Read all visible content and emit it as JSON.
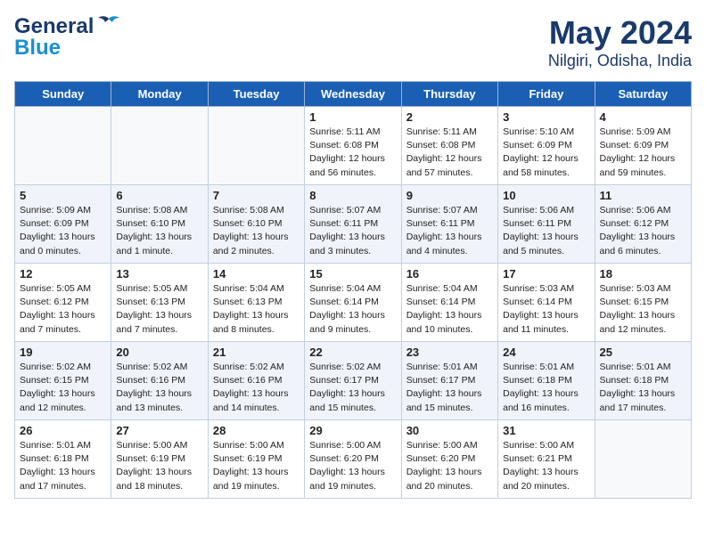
{
  "header": {
    "logo_line1": "General",
    "logo_line2": "Blue",
    "month": "May 2024",
    "location": "Nilgiri, Odisha, India"
  },
  "weekdays": [
    "Sunday",
    "Monday",
    "Tuesday",
    "Wednesday",
    "Thursday",
    "Friday",
    "Saturday"
  ],
  "weeks": [
    [
      {
        "day": "",
        "sunrise": "",
        "sunset": "",
        "daylight": ""
      },
      {
        "day": "",
        "sunrise": "",
        "sunset": "",
        "daylight": ""
      },
      {
        "day": "",
        "sunrise": "",
        "sunset": "",
        "daylight": ""
      },
      {
        "day": "1",
        "sunrise": "Sunrise: 5:11 AM",
        "sunset": "Sunset: 6:08 PM",
        "daylight": "Daylight: 12 hours and 56 minutes."
      },
      {
        "day": "2",
        "sunrise": "Sunrise: 5:11 AM",
        "sunset": "Sunset: 6:08 PM",
        "daylight": "Daylight: 12 hours and 57 minutes."
      },
      {
        "day": "3",
        "sunrise": "Sunrise: 5:10 AM",
        "sunset": "Sunset: 6:09 PM",
        "daylight": "Daylight: 12 hours and 58 minutes."
      },
      {
        "day": "4",
        "sunrise": "Sunrise: 5:09 AM",
        "sunset": "Sunset: 6:09 PM",
        "daylight": "Daylight: 12 hours and 59 minutes."
      }
    ],
    [
      {
        "day": "5",
        "sunrise": "Sunrise: 5:09 AM",
        "sunset": "Sunset: 6:09 PM",
        "daylight": "Daylight: 13 hours and 0 minutes."
      },
      {
        "day": "6",
        "sunrise": "Sunrise: 5:08 AM",
        "sunset": "Sunset: 6:10 PM",
        "daylight": "Daylight: 13 hours and 1 minute."
      },
      {
        "day": "7",
        "sunrise": "Sunrise: 5:08 AM",
        "sunset": "Sunset: 6:10 PM",
        "daylight": "Daylight: 13 hours and 2 minutes."
      },
      {
        "day": "8",
        "sunrise": "Sunrise: 5:07 AM",
        "sunset": "Sunset: 6:11 PM",
        "daylight": "Daylight: 13 hours and 3 minutes."
      },
      {
        "day": "9",
        "sunrise": "Sunrise: 5:07 AM",
        "sunset": "Sunset: 6:11 PM",
        "daylight": "Daylight: 13 hours and 4 minutes."
      },
      {
        "day": "10",
        "sunrise": "Sunrise: 5:06 AM",
        "sunset": "Sunset: 6:11 PM",
        "daylight": "Daylight: 13 hours and 5 minutes."
      },
      {
        "day": "11",
        "sunrise": "Sunrise: 5:06 AM",
        "sunset": "Sunset: 6:12 PM",
        "daylight": "Daylight: 13 hours and 6 minutes."
      }
    ],
    [
      {
        "day": "12",
        "sunrise": "Sunrise: 5:05 AM",
        "sunset": "Sunset: 6:12 PM",
        "daylight": "Daylight: 13 hours and 7 minutes."
      },
      {
        "day": "13",
        "sunrise": "Sunrise: 5:05 AM",
        "sunset": "Sunset: 6:13 PM",
        "daylight": "Daylight: 13 hours and 7 minutes."
      },
      {
        "day": "14",
        "sunrise": "Sunrise: 5:04 AM",
        "sunset": "Sunset: 6:13 PM",
        "daylight": "Daylight: 13 hours and 8 minutes."
      },
      {
        "day": "15",
        "sunrise": "Sunrise: 5:04 AM",
        "sunset": "Sunset: 6:14 PM",
        "daylight": "Daylight: 13 hours and 9 minutes."
      },
      {
        "day": "16",
        "sunrise": "Sunrise: 5:04 AM",
        "sunset": "Sunset: 6:14 PM",
        "daylight": "Daylight: 13 hours and 10 minutes."
      },
      {
        "day": "17",
        "sunrise": "Sunrise: 5:03 AM",
        "sunset": "Sunset: 6:14 PM",
        "daylight": "Daylight: 13 hours and 11 minutes."
      },
      {
        "day": "18",
        "sunrise": "Sunrise: 5:03 AM",
        "sunset": "Sunset: 6:15 PM",
        "daylight": "Daylight: 13 hours and 12 minutes."
      }
    ],
    [
      {
        "day": "19",
        "sunrise": "Sunrise: 5:02 AM",
        "sunset": "Sunset: 6:15 PM",
        "daylight": "Daylight: 13 hours and 12 minutes."
      },
      {
        "day": "20",
        "sunrise": "Sunrise: 5:02 AM",
        "sunset": "Sunset: 6:16 PM",
        "daylight": "Daylight: 13 hours and 13 minutes."
      },
      {
        "day": "21",
        "sunrise": "Sunrise: 5:02 AM",
        "sunset": "Sunset: 6:16 PM",
        "daylight": "Daylight: 13 hours and 14 minutes."
      },
      {
        "day": "22",
        "sunrise": "Sunrise: 5:02 AM",
        "sunset": "Sunset: 6:17 PM",
        "daylight": "Daylight: 13 hours and 15 minutes."
      },
      {
        "day": "23",
        "sunrise": "Sunrise: 5:01 AM",
        "sunset": "Sunset: 6:17 PM",
        "daylight": "Daylight: 13 hours and 15 minutes."
      },
      {
        "day": "24",
        "sunrise": "Sunrise: 5:01 AM",
        "sunset": "Sunset: 6:18 PM",
        "daylight": "Daylight: 13 hours and 16 minutes."
      },
      {
        "day": "25",
        "sunrise": "Sunrise: 5:01 AM",
        "sunset": "Sunset: 6:18 PM",
        "daylight": "Daylight: 13 hours and 17 minutes."
      }
    ],
    [
      {
        "day": "26",
        "sunrise": "Sunrise: 5:01 AM",
        "sunset": "Sunset: 6:18 PM",
        "daylight": "Daylight: 13 hours and 17 minutes."
      },
      {
        "day": "27",
        "sunrise": "Sunrise: 5:00 AM",
        "sunset": "Sunset: 6:19 PM",
        "daylight": "Daylight: 13 hours and 18 minutes."
      },
      {
        "day": "28",
        "sunrise": "Sunrise: 5:00 AM",
        "sunset": "Sunset: 6:19 PM",
        "daylight": "Daylight: 13 hours and 19 minutes."
      },
      {
        "day": "29",
        "sunrise": "Sunrise: 5:00 AM",
        "sunset": "Sunset: 6:20 PM",
        "daylight": "Daylight: 13 hours and 19 minutes."
      },
      {
        "day": "30",
        "sunrise": "Sunrise: 5:00 AM",
        "sunset": "Sunset: 6:20 PM",
        "daylight": "Daylight: 13 hours and 20 minutes."
      },
      {
        "day": "31",
        "sunrise": "Sunrise: 5:00 AM",
        "sunset": "Sunset: 6:21 PM",
        "daylight": "Daylight: 13 hours and 20 minutes."
      },
      {
        "day": "",
        "sunrise": "",
        "sunset": "",
        "daylight": ""
      }
    ]
  ]
}
